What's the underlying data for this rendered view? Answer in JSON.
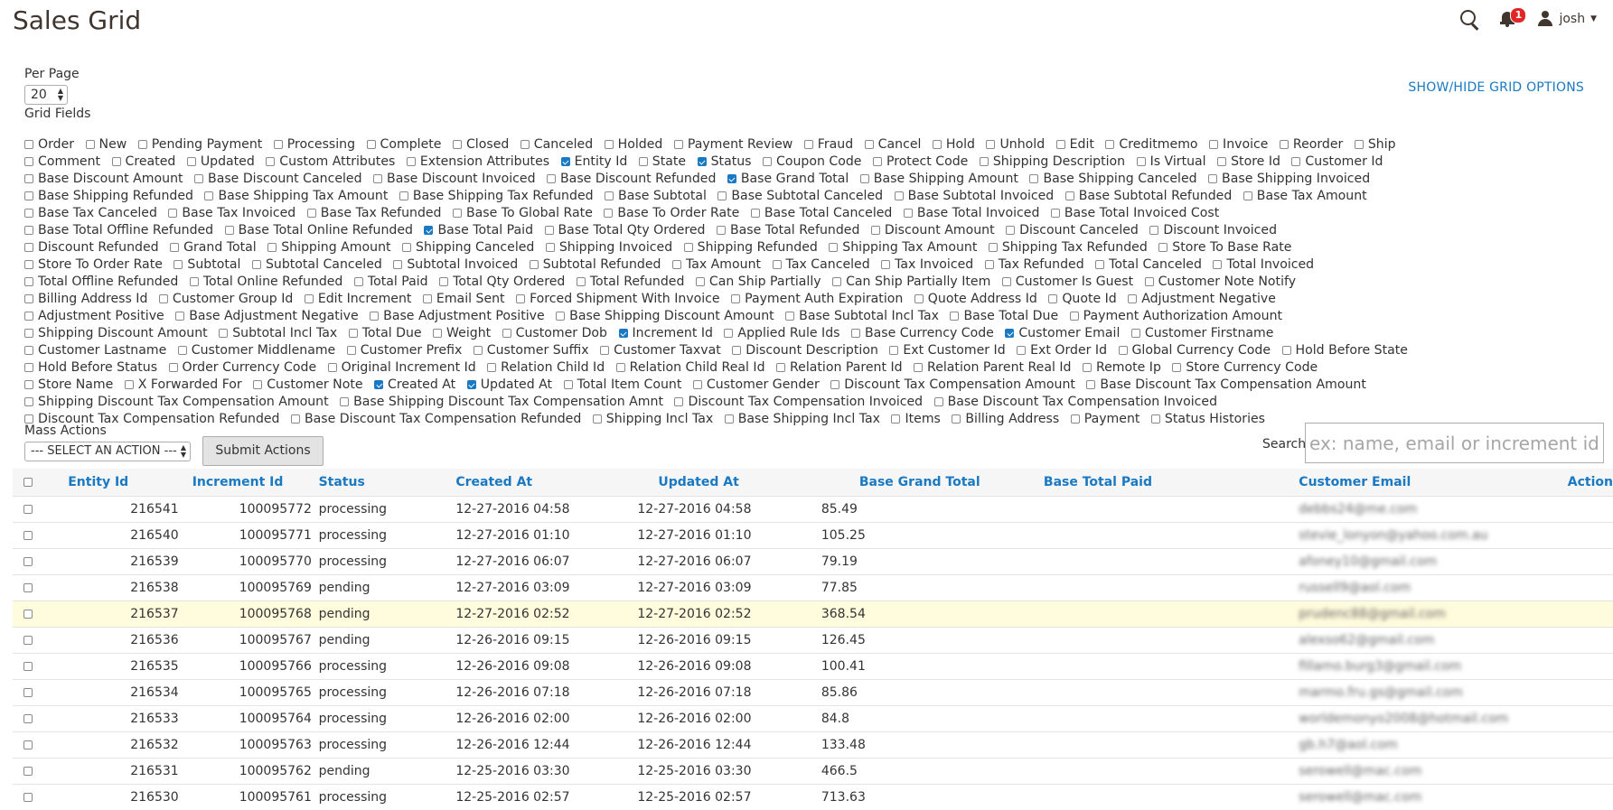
{
  "page": {
    "title": "Sales Grid"
  },
  "header": {
    "notification_count": "1",
    "user_name": "josh"
  },
  "per_page": {
    "label": "Per Page",
    "value": "20"
  },
  "grid_fields": {
    "label": "Grid Fields",
    "options": [
      {
        "label": "Order",
        "checked": false
      },
      {
        "label": "New",
        "checked": false
      },
      {
        "label": "Pending Payment",
        "checked": false
      },
      {
        "label": "Processing",
        "checked": false
      },
      {
        "label": "Complete",
        "checked": false
      },
      {
        "label": "Closed",
        "checked": false
      },
      {
        "label": "Canceled",
        "checked": false
      },
      {
        "label": "Holded",
        "checked": false
      },
      {
        "label": "Payment Review",
        "checked": false
      },
      {
        "label": "Fraud",
        "checked": false
      },
      {
        "label": "Cancel",
        "checked": false
      },
      {
        "label": "Hold",
        "checked": false
      },
      {
        "label": "Unhold",
        "checked": false
      },
      {
        "label": "Edit",
        "checked": false
      },
      {
        "label": "Creditmemo",
        "checked": false
      },
      {
        "label": "Invoice",
        "checked": false
      },
      {
        "label": "Reorder",
        "checked": false
      },
      {
        "label": "Ship",
        "checked": false
      },
      {
        "label": "Comment",
        "checked": false
      },
      {
        "label": "Created",
        "checked": false
      },
      {
        "label": "Updated",
        "checked": false
      },
      {
        "label": "Custom Attributes",
        "checked": false
      },
      {
        "label": "Extension Attributes",
        "checked": false
      },
      {
        "label": "Entity Id",
        "checked": true
      },
      {
        "label": "State",
        "checked": false
      },
      {
        "label": "Status",
        "checked": true
      },
      {
        "label": "Coupon Code",
        "checked": false
      },
      {
        "label": "Protect Code",
        "checked": false
      },
      {
        "label": "Shipping Description",
        "checked": false
      },
      {
        "label": "Is Virtual",
        "checked": false
      },
      {
        "label": "Store Id",
        "checked": false
      },
      {
        "label": "Customer Id",
        "checked": false
      },
      {
        "label": "Base Discount Amount",
        "checked": false
      },
      {
        "label": "Base Discount Canceled",
        "checked": false
      },
      {
        "label": "Base Discount Invoiced",
        "checked": false
      },
      {
        "label": "Base Discount Refunded",
        "checked": false
      },
      {
        "label": "Base Grand Total",
        "checked": true
      },
      {
        "label": "Base Shipping Amount",
        "checked": false
      },
      {
        "label": "Base Shipping Canceled",
        "checked": false
      },
      {
        "label": "Base Shipping Invoiced",
        "checked": false
      },
      {
        "label": "Base Shipping Refunded",
        "checked": false
      },
      {
        "label": "Base Shipping Tax Amount",
        "checked": false
      },
      {
        "label": "Base Shipping Tax Refunded",
        "checked": false
      },
      {
        "label": "Base Subtotal",
        "checked": false
      },
      {
        "label": "Base Subtotal Canceled",
        "checked": false
      },
      {
        "label": "Base Subtotal Invoiced",
        "checked": false
      },
      {
        "label": "Base Subtotal Refunded",
        "checked": false
      },
      {
        "label": "Base Tax Amount",
        "checked": false
      },
      {
        "label": "Base Tax Canceled",
        "checked": false
      },
      {
        "label": "Base Tax Invoiced",
        "checked": false
      },
      {
        "label": "Base Tax Refunded",
        "checked": false
      },
      {
        "label": "Base To Global Rate",
        "checked": false
      },
      {
        "label": "Base To Order Rate",
        "checked": false
      },
      {
        "label": "Base Total Canceled",
        "checked": false
      },
      {
        "label": "Base Total Invoiced",
        "checked": false
      },
      {
        "label": "Base Total Invoiced Cost",
        "checked": false
      },
      {
        "label": "Base Total Offline Refunded",
        "checked": false
      },
      {
        "label": "Base Total Online Refunded",
        "checked": false
      },
      {
        "label": "Base Total Paid",
        "checked": true
      },
      {
        "label": "Base Total Qty Ordered",
        "checked": false
      },
      {
        "label": "Base Total Refunded",
        "checked": false
      },
      {
        "label": "Discount Amount",
        "checked": false
      },
      {
        "label": "Discount Canceled",
        "checked": false
      },
      {
        "label": "Discount Invoiced",
        "checked": false
      },
      {
        "label": "Discount Refunded",
        "checked": false
      },
      {
        "label": "Grand Total",
        "checked": false
      },
      {
        "label": "Shipping Amount",
        "checked": false
      },
      {
        "label": "Shipping Canceled",
        "checked": false
      },
      {
        "label": "Shipping Invoiced",
        "checked": false
      },
      {
        "label": "Shipping Refunded",
        "checked": false
      },
      {
        "label": "Shipping Tax Amount",
        "checked": false
      },
      {
        "label": "Shipping Tax Refunded",
        "checked": false
      },
      {
        "label": "Store To Base Rate",
        "checked": false
      },
      {
        "label": "Store To Order Rate",
        "checked": false
      },
      {
        "label": "Subtotal",
        "checked": false
      },
      {
        "label": "Subtotal Canceled",
        "checked": false
      },
      {
        "label": "Subtotal Invoiced",
        "checked": false
      },
      {
        "label": "Subtotal Refunded",
        "checked": false
      },
      {
        "label": "Tax Amount",
        "checked": false
      },
      {
        "label": "Tax Canceled",
        "checked": false
      },
      {
        "label": "Tax Invoiced",
        "checked": false
      },
      {
        "label": "Tax Refunded",
        "checked": false
      },
      {
        "label": "Total Canceled",
        "checked": false
      },
      {
        "label": "Total Invoiced",
        "checked": false
      },
      {
        "label": "Total Offline Refunded",
        "checked": false
      },
      {
        "label": "Total Online Refunded",
        "checked": false
      },
      {
        "label": "Total Paid",
        "checked": false
      },
      {
        "label": "Total Qty Ordered",
        "checked": false
      },
      {
        "label": "Total Refunded",
        "checked": false
      },
      {
        "label": "Can Ship Partially",
        "checked": false
      },
      {
        "label": "Can Ship Partially Item",
        "checked": false
      },
      {
        "label": "Customer Is Guest",
        "checked": false
      },
      {
        "label": "Customer Note Notify",
        "checked": false
      },
      {
        "label": "Billing Address Id",
        "checked": false
      },
      {
        "label": "Customer Group Id",
        "checked": false
      },
      {
        "label": "Edit Increment",
        "checked": false
      },
      {
        "label": "Email Sent",
        "checked": false
      },
      {
        "label": "Forced Shipment With Invoice",
        "checked": false
      },
      {
        "label": "Payment Auth Expiration",
        "checked": false
      },
      {
        "label": "Quote Address Id",
        "checked": false
      },
      {
        "label": "Quote Id",
        "checked": false
      },
      {
        "label": "Adjustment Negative",
        "checked": false
      },
      {
        "label": "Adjustment Positive",
        "checked": false
      },
      {
        "label": "Base Adjustment Negative",
        "checked": false
      },
      {
        "label": "Base Adjustment Positive",
        "checked": false
      },
      {
        "label": "Base Shipping Discount Amount",
        "checked": false
      },
      {
        "label": "Base Subtotal Incl Tax",
        "checked": false
      },
      {
        "label": "Base Total Due",
        "checked": false
      },
      {
        "label": "Payment Authorization Amount",
        "checked": false
      },
      {
        "label": "Shipping Discount Amount",
        "checked": false
      },
      {
        "label": "Subtotal Incl Tax",
        "checked": false
      },
      {
        "label": "Total Due",
        "checked": false
      },
      {
        "label": "Weight",
        "checked": false
      },
      {
        "label": "Customer Dob",
        "checked": false
      },
      {
        "label": "Increment Id",
        "checked": true
      },
      {
        "label": "Applied Rule Ids",
        "checked": false
      },
      {
        "label": "Base Currency Code",
        "checked": false
      },
      {
        "label": "Customer Email",
        "checked": true
      },
      {
        "label": "Customer Firstname",
        "checked": false
      },
      {
        "label": "Customer Lastname",
        "checked": false
      },
      {
        "label": "Customer Middlename",
        "checked": false
      },
      {
        "label": "Customer Prefix",
        "checked": false
      },
      {
        "label": "Customer Suffix",
        "checked": false
      },
      {
        "label": "Customer Taxvat",
        "checked": false
      },
      {
        "label": "Discount Description",
        "checked": false
      },
      {
        "label": "Ext Customer Id",
        "checked": false
      },
      {
        "label": "Ext Order Id",
        "checked": false
      },
      {
        "label": "Global Currency Code",
        "checked": false
      },
      {
        "label": "Hold Before State",
        "checked": false
      },
      {
        "label": "Hold Before Status",
        "checked": false
      },
      {
        "label": "Order Currency Code",
        "checked": false
      },
      {
        "label": "Original Increment Id",
        "checked": false
      },
      {
        "label": "Relation Child Id",
        "checked": false
      },
      {
        "label": "Relation Child Real Id",
        "checked": false
      },
      {
        "label": "Relation Parent Id",
        "checked": false
      },
      {
        "label": "Relation Parent Real Id",
        "checked": false
      },
      {
        "label": "Remote Ip",
        "checked": false
      },
      {
        "label": "Store Currency Code",
        "checked": false
      },
      {
        "label": "Store Name",
        "checked": false
      },
      {
        "label": "X Forwarded For",
        "checked": false
      },
      {
        "label": "Customer Note",
        "checked": false
      },
      {
        "label": "Created At",
        "checked": true
      },
      {
        "label": "Updated At",
        "checked": true
      },
      {
        "label": "Total Item Count",
        "checked": false
      },
      {
        "label": "Customer Gender",
        "checked": false
      },
      {
        "label": "Discount Tax Compensation Amount",
        "checked": false
      },
      {
        "label": "Base Discount Tax Compensation Amount",
        "checked": false
      },
      {
        "label": "Shipping Discount Tax Compensation Amount",
        "checked": false
      },
      {
        "label": "Base Shipping Discount Tax Compensation Amnt",
        "checked": false
      },
      {
        "label": "Discount Tax Compensation Invoiced",
        "checked": false
      },
      {
        "label": "Base Discount Tax Compensation Invoiced",
        "checked": false
      },
      {
        "label": "Discount Tax Compensation Refunded",
        "checked": false
      },
      {
        "label": "Base Discount Tax Compensation Refunded",
        "checked": false
      },
      {
        "label": "Shipping Incl Tax",
        "checked": false
      },
      {
        "label": "Base Shipping Incl Tax",
        "checked": false
      },
      {
        "label": "Items",
        "checked": false
      },
      {
        "label": "Billing Address",
        "checked": false
      },
      {
        "label": "Payment",
        "checked": false
      },
      {
        "label": "Status Histories",
        "checked": false
      }
    ]
  },
  "grid_options_link": "SHOW/HIDE GRID OPTIONS",
  "mass_actions": {
    "label": "Mass Actions",
    "selected": "--- SELECT AN ACTION ---",
    "submit_label": "Submit Actions"
  },
  "search": {
    "label": "Search",
    "placeholder": "ex: name, email or increment id"
  },
  "table": {
    "columns": [
      "Entity Id",
      "Increment Id",
      "Status",
      "Created At",
      "Updated At",
      "Base Grand Total",
      "Base Total Paid",
      "Customer Email",
      "Action"
    ],
    "rows": [
      {
        "entity_id": "216541",
        "increment_id": "100095772",
        "status": "processing",
        "created_at": "12-27-2016 04:58",
        "updated_at": "12-27-2016 04:58",
        "base_grand_total": "85.49",
        "base_total_paid": "",
        "customer_email": "debbs24@me.com",
        "highlight": false
      },
      {
        "entity_id": "216540",
        "increment_id": "100095771",
        "status": "processing",
        "created_at": "12-27-2016 01:10",
        "updated_at": "12-27-2016 01:10",
        "base_grand_total": "105.25",
        "base_total_paid": "",
        "customer_email": "stevie_lonyon@yahoo.com.au",
        "highlight": false
      },
      {
        "entity_id": "216539",
        "increment_id": "100095770",
        "status": "processing",
        "created_at": "12-27-2016 06:07",
        "updated_at": "12-27-2016 06:07",
        "base_grand_total": "79.19",
        "base_total_paid": "",
        "customer_email": "afoney10@gmail.com",
        "highlight": false
      },
      {
        "entity_id": "216538",
        "increment_id": "100095769",
        "status": "pending",
        "created_at": "12-27-2016 03:09",
        "updated_at": "12-27-2016 03:09",
        "base_grand_total": "77.85",
        "base_total_paid": "",
        "customer_email": "russell9@aol.com",
        "highlight": false
      },
      {
        "entity_id": "216537",
        "increment_id": "100095768",
        "status": "pending",
        "created_at": "12-27-2016 02:52",
        "updated_at": "12-27-2016 02:52",
        "base_grand_total": "368.54",
        "base_total_paid": "",
        "customer_email": "prudenc88@gmail.com",
        "highlight": true
      },
      {
        "entity_id": "216536",
        "increment_id": "100095767",
        "status": "pending",
        "created_at": "12-26-2016 09:15",
        "updated_at": "12-26-2016 09:15",
        "base_grand_total": "126.45",
        "base_total_paid": "",
        "customer_email": "alexso62@gmail.com",
        "highlight": false
      },
      {
        "entity_id": "216535",
        "increment_id": "100095766",
        "status": "processing",
        "created_at": "12-26-2016 09:08",
        "updated_at": "12-26-2016 09:08",
        "base_grand_total": "100.41",
        "base_total_paid": "",
        "customer_email": "fillamo.burg3@gmail.com",
        "highlight": false
      },
      {
        "entity_id": "216534",
        "increment_id": "100095765",
        "status": "processing",
        "created_at": "12-26-2016 07:18",
        "updated_at": "12-26-2016 07:18",
        "base_grand_total": "85.86",
        "base_total_paid": "",
        "customer_email": "marmo.fru.gs@gmail.com",
        "highlight": false
      },
      {
        "entity_id": "216533",
        "increment_id": "100095764",
        "status": "processing",
        "created_at": "12-26-2016 02:00",
        "updated_at": "12-26-2016 02:00",
        "base_grand_total": "84.8",
        "base_total_paid": "",
        "customer_email": "worldemonyo2008@hotmail.com",
        "highlight": false
      },
      {
        "entity_id": "216532",
        "increment_id": "100095763",
        "status": "processing",
        "created_at": "12-26-2016 12:44",
        "updated_at": "12-26-2016 12:44",
        "base_grand_total": "133.48",
        "base_total_paid": "",
        "customer_email": "gb.h7@aol.com",
        "highlight": false
      },
      {
        "entity_id": "216531",
        "increment_id": "100095762",
        "status": "pending",
        "created_at": "12-25-2016 03:30",
        "updated_at": "12-25-2016 03:30",
        "base_grand_total": "466.5",
        "base_total_paid": "",
        "customer_email": "serowell@mac.com",
        "highlight": false
      },
      {
        "entity_id": "216530",
        "increment_id": "100095761",
        "status": "processing",
        "created_at": "12-25-2016 02:57",
        "updated_at": "12-25-2016 02:57",
        "base_grand_total": "713.63",
        "base_total_paid": "",
        "customer_email": "serowell@mac.com",
        "highlight": false
      }
    ]
  }
}
